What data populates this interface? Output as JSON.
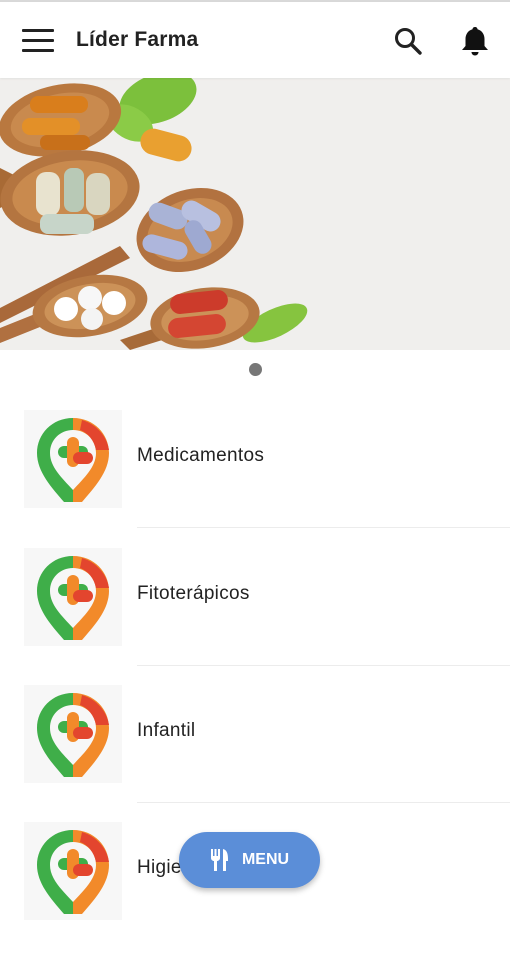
{
  "app": {
    "title": "Líder Farma"
  },
  "header": {
    "menu_icon": "hamburger-menu-icon",
    "search_icon": "search-icon",
    "notifications_icon": "bell-icon"
  },
  "banner": {
    "alt": "pills on wooden spoons",
    "slide_count": 1,
    "active_slide": 1
  },
  "categories": [
    {
      "label": "Medicamentos",
      "icon": "pharmacy-location-logo"
    },
    {
      "label": "Fitoterápicos",
      "icon": "pharmacy-location-logo"
    },
    {
      "label": "Infantil",
      "icon": "pharmacy-location-logo"
    },
    {
      "label": "Higie",
      "icon": "pharmacy-location-logo"
    }
  ],
  "fab": {
    "label": "MENU",
    "icon": "fork-knife-icon"
  },
  "colors": {
    "fab": "#5b8ed8",
    "logo_green": "#3fae49",
    "logo_orange": "#f28a2a",
    "logo_red": "#e3452e"
  }
}
